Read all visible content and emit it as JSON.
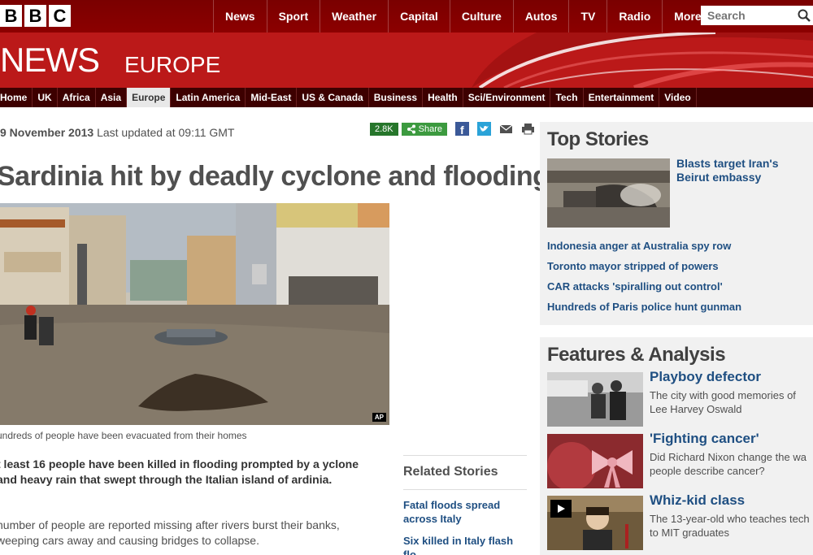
{
  "brand": {
    "logo_letters": [
      "B",
      "B",
      "C"
    ]
  },
  "topnav": {
    "items": [
      "News",
      "Sport",
      "Weather",
      "Capital",
      "Culture",
      "Autos",
      "TV",
      "Radio",
      "More..."
    ],
    "search_placeholder": "Search"
  },
  "banner": {
    "title": "NEWS",
    "section": "EUROPE"
  },
  "secnav": {
    "items": [
      "Home",
      "UK",
      "Africa",
      "Asia",
      "Europe",
      "Latin America",
      "Mid-East",
      "US & Canada",
      "Business",
      "Health",
      "Sci/Environment",
      "Tech",
      "Entertainment",
      "Video"
    ],
    "active": "Europe"
  },
  "article": {
    "date": "9 November 2013",
    "updated": "Last updated at 09:11 GMT",
    "share_count": "2.8K",
    "share_label": "Share",
    "headline": "Sardinia hit by deadly cyclone and flooding",
    "photo_credit": "AP",
    "caption": "undreds of people have been evacuated from their homes",
    "lead": "t least 16 people have been killed in flooding prompted by a yclone and heavy rain that swept through the Italian island of ardinia.",
    "body": " number of people are reported missing after rivers burst their banks, weeping cars away and causing bridges to collapse."
  },
  "related": {
    "title": "Related Stories",
    "links": [
      "Fatal floods spread across Italy",
      "Six killed in Italy flash flo..."
    ]
  },
  "top_stories": {
    "title": "Top Stories",
    "main": "Blasts target Iran's Beirut embassy",
    "links": [
      "Indonesia anger at Australia spy row",
      "Toronto mayor stripped of powers",
      "CAR attacks 'spiralling out control'",
      "Hundreds of Paris police hunt gunman"
    ]
  },
  "features": {
    "title": "Features & Analysis",
    "items": [
      {
        "title": "Playboy defector",
        "desc": "The city with good memories of Lee Harvey Oswald"
      },
      {
        "title": "'Fighting cancer'",
        "desc": "Did Richard Nixon change the wa people describe cancer?"
      },
      {
        "title": "Whiz-kid class",
        "desc": "The 13-year-old who teaches tech to MIT graduates"
      }
    ]
  },
  "colors": {
    "brand_red": "#bb1919",
    "link_blue": "#1f4f82",
    "share_green": "#3c9a3f"
  }
}
